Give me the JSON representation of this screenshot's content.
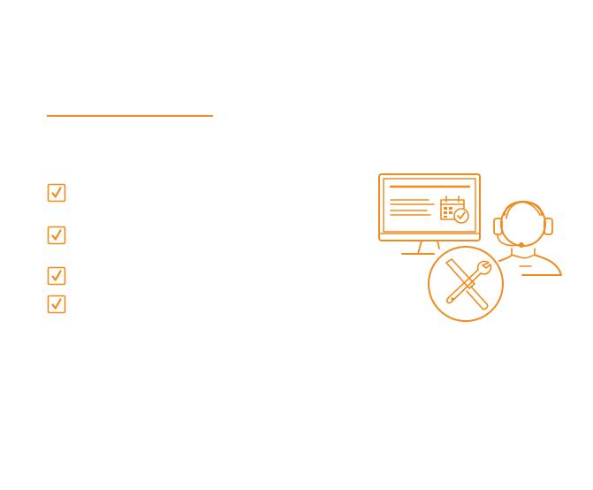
{
  "accent_color": "#f08a1c",
  "heading": "",
  "checklist": [
    {
      "icon": "checkbox-checked-icon",
      "label": ""
    },
    {
      "icon": "checkbox-checked-icon",
      "label": ""
    },
    {
      "icon": "checkbox-checked-icon",
      "label": ""
    },
    {
      "icon": "checkbox-checked-icon",
      "label": ""
    }
  ],
  "illustration": {
    "icons": [
      "monitor-icon",
      "calendar-check-icon",
      "support-agent-headset-icon",
      "tools-wrench-screwdriver-icon"
    ]
  }
}
